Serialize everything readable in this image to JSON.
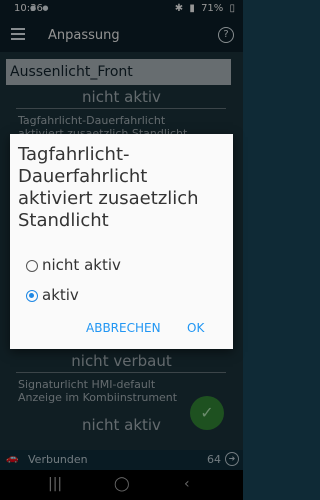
{
  "status": {
    "time": "10:36",
    "battery": "71%"
  },
  "appbar": {
    "title": "Anpassung",
    "help": "?"
  },
  "section": {
    "header": "Aussenlicht_Front"
  },
  "rows": [
    {
      "value": "nicht aktiv"
    },
    {
      "label": "Tagfahrlicht-Dauerfahrlicht",
      "label2": "aktiviert zusaetzlich Standlicht"
    },
    {
      "value": "nicht verbaut"
    },
    {
      "label": "Signaturlicht HMI-default",
      "label2": "Anzeige im Kombiinstrument"
    },
    {
      "value": "nicht aktiv"
    }
  ],
  "dialog": {
    "title": "Tagfahrlicht-Dauerfahrlicht aktiviert zusaetzlich Standlicht",
    "options": [
      {
        "label": "nicht aktiv",
        "selected": false
      },
      {
        "label": "aktiv",
        "selected": true
      }
    ],
    "cancel": "ABBRECHEN",
    "ok": "OK"
  },
  "bottom": {
    "connection": "Verbunden",
    "count": "64"
  }
}
